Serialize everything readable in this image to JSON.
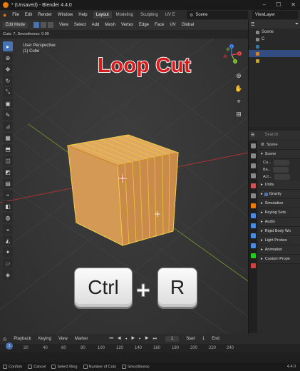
{
  "titlebar": {
    "title": "* (Unsaved) - Blender 4.4.0"
  },
  "menubar": {
    "menus": [
      "File",
      "Edit",
      "Render",
      "Window",
      "Help"
    ],
    "workspaces": [
      "Layout",
      "Modeling",
      "Sculpting",
      "UV E"
    ],
    "active_workspace": "Layout",
    "scene": "Scene",
    "view_layer": "ViewLayer"
  },
  "viewport_header": {
    "mode": "Edit Mode",
    "menus": [
      "View",
      "Select",
      "Add",
      "Mesh",
      "Vertex",
      "Edge",
      "Face",
      "UV"
    ],
    "transform": "Global"
  },
  "operator_info": "Cuts: 7, Smoothness: 0.00",
  "viewport": {
    "view_name": "User Perspective",
    "object_name": "(1) Cube",
    "overlay_title": "Loop Cut",
    "key_ctrl": "Ctrl",
    "key_plus": "+",
    "key_r": "R"
  },
  "gizmo": {
    "x": "X",
    "y": "Y",
    "z": "Z"
  },
  "outliner": {
    "search_placeholder": "",
    "root": "Scene",
    "rows": [
      "C",
      "",
      "",
      ""
    ]
  },
  "properties": {
    "search_placeholder": "Search",
    "header": "Scene",
    "panel_scene": "Scene",
    "fields": [
      {
        "label": "Ca...",
        "value": ""
      },
      {
        "label": "Ba...",
        "value": ""
      },
      {
        "label": "Act...",
        "value": ""
      }
    ],
    "panels": [
      "Units",
      "Gravity",
      "Simulation",
      "Keying Sets",
      "Audio",
      "Rigid Body Wo",
      "Light Probes",
      "Animation",
      "Custom Prope"
    ]
  },
  "timeline": {
    "menus": [
      "Playback",
      "Keying",
      "View",
      "Marker"
    ],
    "current_frame": "1",
    "start_label": "Start",
    "start_value": "1",
    "end_label": "End",
    "frame_numbers": [
      "20",
      "40",
      "60",
      "80",
      "100",
      "120",
      "140",
      "160",
      "180",
      "200",
      "220",
      "240"
    ]
  },
  "statusbar": {
    "items": [
      "Confirm",
      "Cancel",
      "Select Ring",
      "Number of Cuts",
      "Smoothness"
    ],
    "version": "4.4.0"
  }
}
